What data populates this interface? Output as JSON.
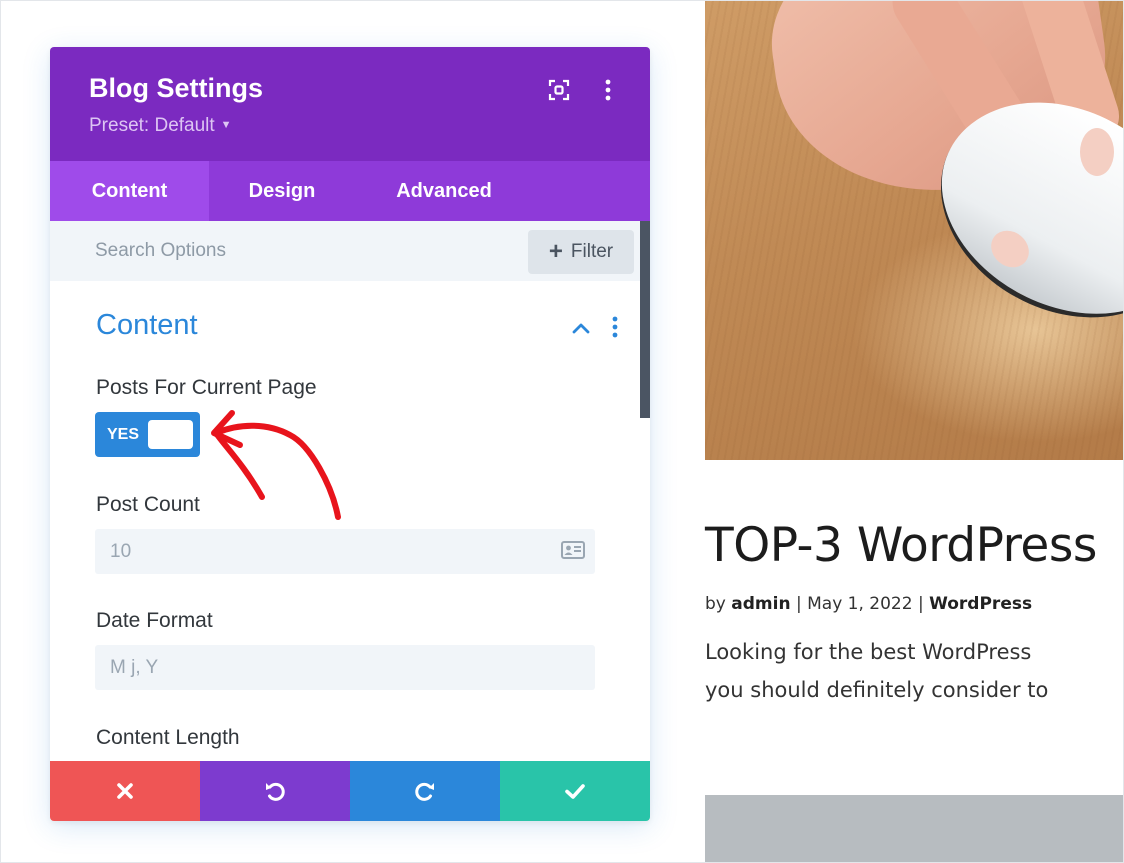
{
  "panel": {
    "title": "Blog Settings",
    "preset": "Preset: Default",
    "tabs": [
      {
        "label": "Content",
        "active": true
      },
      {
        "label": "Design",
        "active": false
      },
      {
        "label": "Advanced",
        "active": false
      }
    ],
    "search": {
      "placeholder": "Search Options"
    },
    "filter_label": "Filter",
    "section": {
      "title": "Content",
      "expanded": true
    },
    "fields": {
      "posts_for_current_page": {
        "label": "Posts For Current Page",
        "toggle_label": "YES",
        "value": true
      },
      "post_count": {
        "label": "Post Count",
        "placeholder": "10"
      },
      "date_format": {
        "label": "Date Format",
        "placeholder": "M j, Y"
      },
      "content_length": {
        "label": "Content Length"
      }
    },
    "footer_icons": [
      "close-icon",
      "undo-icon",
      "redo-icon",
      "check-icon"
    ]
  },
  "preview": {
    "post_title": "TOP-3 WordPress",
    "meta": {
      "by": "by",
      "author": "admin",
      "sep1": "|",
      "date": "May 1, 2022",
      "sep2": "|",
      "category": "WordPress"
    },
    "excerpt": [
      "Looking for the best WordPress",
      "you should definitely consider to"
    ]
  },
  "colors": {
    "header": "#7b2ac0",
    "tabs": "#8e3ad9",
    "active_tab": "#9f4bea",
    "accent_blue": "#2b87da",
    "cancel": "#ef5555",
    "undo": "#7d3bcf",
    "redo": "#2b87da",
    "save": "#29c4a9",
    "annotation": "#e8141c"
  }
}
